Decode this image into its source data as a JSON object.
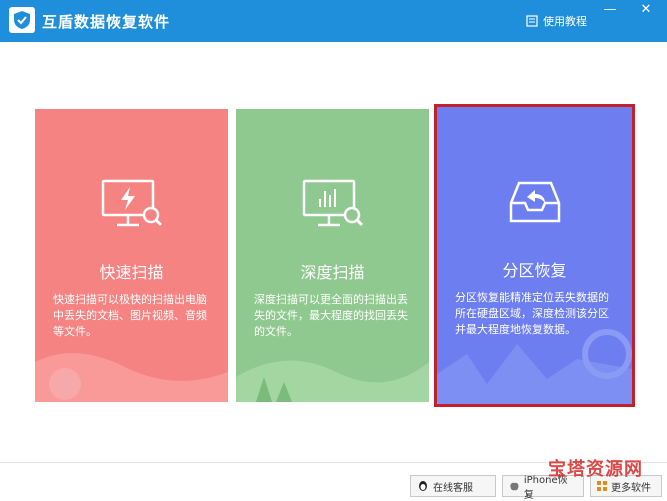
{
  "app": {
    "title": "互盾数据恢复软件",
    "help_label": "使用教程"
  },
  "window_controls": {
    "minimize": "—",
    "close": "✕"
  },
  "cards": {
    "quick": {
      "title": "快速扫描",
      "desc": "快速扫描可以极快的扫描出电脑中丢失的文档、图片视频、音频等文件。",
      "color": "#f58382",
      "icon": "monitor-lightning-search-icon"
    },
    "deep": {
      "title": "深度扫描",
      "desc": "深度扫描可以更全面的扫描出丢失的文件，最大程度的找回丢失的文件。",
      "color": "#8fc98f",
      "icon": "monitor-chart-search-icon"
    },
    "partition": {
      "title": "分区恢复",
      "desc": "分区恢复能精准定位丢失数据的所在硬盘区域，深度检测该分区并最大程度地恢复数据。",
      "color": "#6c7ef0",
      "icon": "inbox-return-icon",
      "selected": true
    }
  },
  "footer": {
    "qq_label": "在线客服",
    "iphone_label": "iPhone恢复",
    "more_label": "更多软件"
  },
  "watermark": "宝塔资源网"
}
